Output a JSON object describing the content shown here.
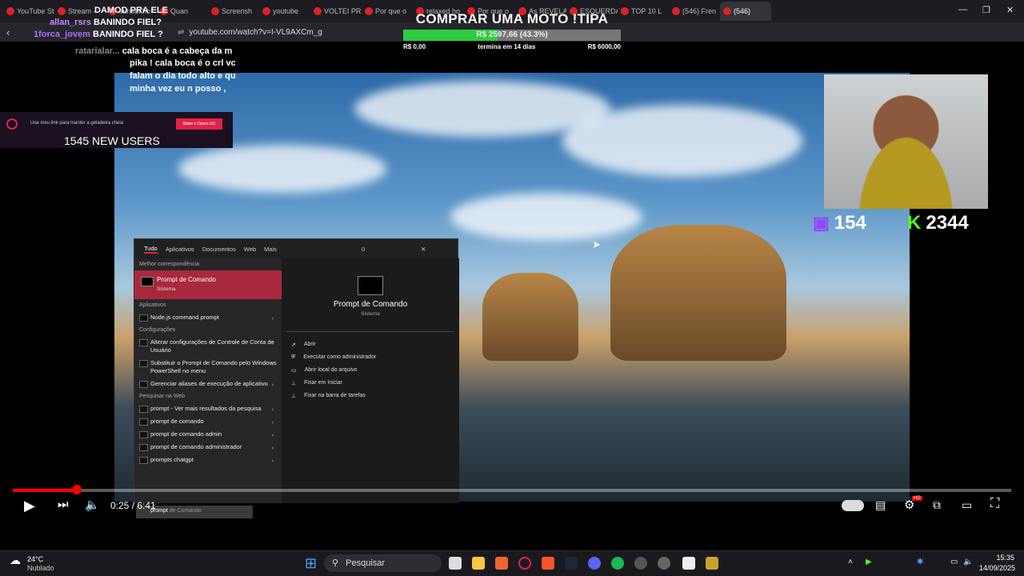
{
  "browser": {
    "tabs": [
      {
        "label": "YouTube Stud",
        "active": false
      },
      {
        "label": "Stream - ",
        "active": false
      },
      {
        "label": "sunset ho",
        "active": false
      },
      {
        "label": "Quan",
        "active": false
      },
      {
        "label": "Screensh",
        "active": false
      },
      {
        "label": "youtube",
        "active": false
      },
      {
        "label": "VOLTEI PR",
        "active": false
      },
      {
        "label": "Por que o",
        "active": false
      },
      {
        "label": "relaxed ho",
        "active": false
      },
      {
        "label": "Por que o",
        "active": false
      },
      {
        "label": "As REVELA",
        "active": false
      },
      {
        "label": "ESQUERDA",
        "active": false
      },
      {
        "label": "TOP 10 L",
        "active": false
      },
      {
        "label": "(546) Fren",
        "active": false
      },
      {
        "label": "(546)",
        "active": true
      }
    ],
    "url": "youtube.com/watch?v=I-VL9AXCm_g"
  },
  "donation": {
    "title": "COMPRAR UMA MOTO !TIPA",
    "bar_text": "R$ 2597,66 (43.3%)",
    "percent": 43.3,
    "min": "R$ 0,00",
    "deadline": "termina em 14 dias",
    "max": "R$ 6000,00"
  },
  "chat": [
    {
      "user": "",
      "text": "DAMOD PRA ELE"
    },
    {
      "user": "allan_rsrs",
      "text": "BANINDO FIEL?"
    },
    {
      "user": "1forca_jovem",
      "text": "BANINDO FIEL ?"
    },
    {
      "user": "ratarialar...",
      "text": "cala boca é a cabeça da m"
    },
    {
      "user": "",
      "text": "pika ! cala boca é o crl vc"
    },
    {
      "user": "",
      "text": "falam o dia todo alto e qu"
    },
    {
      "user": "",
      "text": "minha vez eu n posso ,"
    }
  ],
  "ad": {
    "text": "Use meu link para manter a geladeira cheia",
    "button": "Baixe o Opera GX",
    "users": "1545 NEW USERS"
  },
  "stats": {
    "twitch": "154",
    "kick": "2344"
  },
  "search": {
    "tabs": [
      "Tudo",
      "Aplicativos",
      "Documentos",
      "Web",
      "Mais"
    ],
    "count": "0",
    "best_header": "Melhor correspondência",
    "best_title": "Prompt de Comando",
    "best_sub": "Sistema",
    "apps_header": "Aplicativos",
    "apps": [
      "Node.js command prompt"
    ],
    "config_header": "Configurações",
    "configs": [
      "Alterar configurações de Controle de Conta de Usuário",
      "Substituir o Prompt de Comando pelo Windows PowerShell no menu",
      "Gerenciar aliases de execução de aplicativo"
    ],
    "web_header": "Pesquisar na Web",
    "web": [
      "prompt - Ver mais resultados da pesquisa",
      "prompt de comando",
      "prompt de comando admin",
      "prompt de comando administrador",
      "prompts chatgpt"
    ],
    "right_title": "Prompt de Comando",
    "right_sub": "Sistema",
    "actions": [
      "Abrir",
      "Executar como administrador",
      "Abrir local do arquivo",
      "Fixar em Iniciar",
      "Fixar na barra de tarefas"
    ],
    "query": "prompt",
    "query_hint": "de Comando"
  },
  "player": {
    "time": "0:25 / 6:41",
    "progress": 0.063,
    "hd": "HD"
  },
  "taskbar": {
    "weather_temp": "24°C",
    "weather_desc": "Nublado",
    "search_placeholder": "Pesquisar",
    "time": "15:35",
    "date": "14/09/2025"
  }
}
